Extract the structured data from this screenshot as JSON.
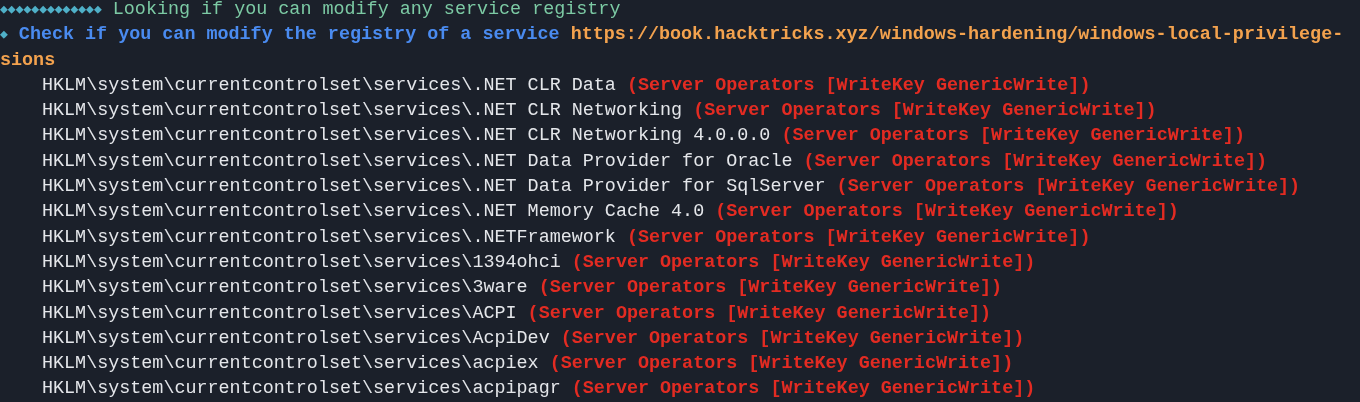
{
  "section_header": {
    "marker": "◆◆◆◆◆◆◆◆◆◆◆◆◆",
    "title": "Looking if you can modify any service registry"
  },
  "check": {
    "marker": "◆",
    "text": "Check if you can modify the registry of a service",
    "url": "https://book.hacktricks.xyz/windows-hardening/windows-local-privilege-",
    "url_continued": "sions"
  },
  "entries": [
    {
      "path": "HKLM\\system\\currentcontrolset\\services\\.NET CLR Data",
      "permission": "(Server Operators [WriteKey GenericWrite])"
    },
    {
      "path": "HKLM\\system\\currentcontrolset\\services\\.NET CLR Networking",
      "permission": "(Server Operators [WriteKey GenericWrite])"
    },
    {
      "path": "HKLM\\system\\currentcontrolset\\services\\.NET CLR Networking 4.0.0.0",
      "permission": "(Server Operators [WriteKey GenericWrite])"
    },
    {
      "path": "HKLM\\system\\currentcontrolset\\services\\.NET Data Provider for Oracle",
      "permission": "(Server Operators [WriteKey GenericWrite])"
    },
    {
      "path": "HKLM\\system\\currentcontrolset\\services\\.NET Data Provider for SqlServer",
      "permission": "(Server Operators [WriteKey GenericWrite])"
    },
    {
      "path": "HKLM\\system\\currentcontrolset\\services\\.NET Memory Cache 4.0",
      "permission": "(Server Operators [WriteKey GenericWrite])"
    },
    {
      "path": "HKLM\\system\\currentcontrolset\\services\\.NETFramework",
      "permission": "(Server Operators [WriteKey GenericWrite])"
    },
    {
      "path": "HKLM\\system\\currentcontrolset\\services\\1394ohci",
      "permission": "(Server Operators [WriteKey GenericWrite])"
    },
    {
      "path": "HKLM\\system\\currentcontrolset\\services\\3ware",
      "permission": "(Server Operators [WriteKey GenericWrite])"
    },
    {
      "path": "HKLM\\system\\currentcontrolset\\services\\ACPI",
      "permission": "(Server Operators [WriteKey GenericWrite])"
    },
    {
      "path": "HKLM\\system\\currentcontrolset\\services\\AcpiDev",
      "permission": "(Server Operators [WriteKey GenericWrite])"
    },
    {
      "path": "HKLM\\system\\currentcontrolset\\services\\acpiex",
      "permission": "(Server Operators [WriteKey GenericWrite])"
    },
    {
      "path": "HKLM\\system\\currentcontrolset\\services\\acpipagr",
      "permission": "(Server Operators [WriteKey GenericWrite])"
    }
  ]
}
